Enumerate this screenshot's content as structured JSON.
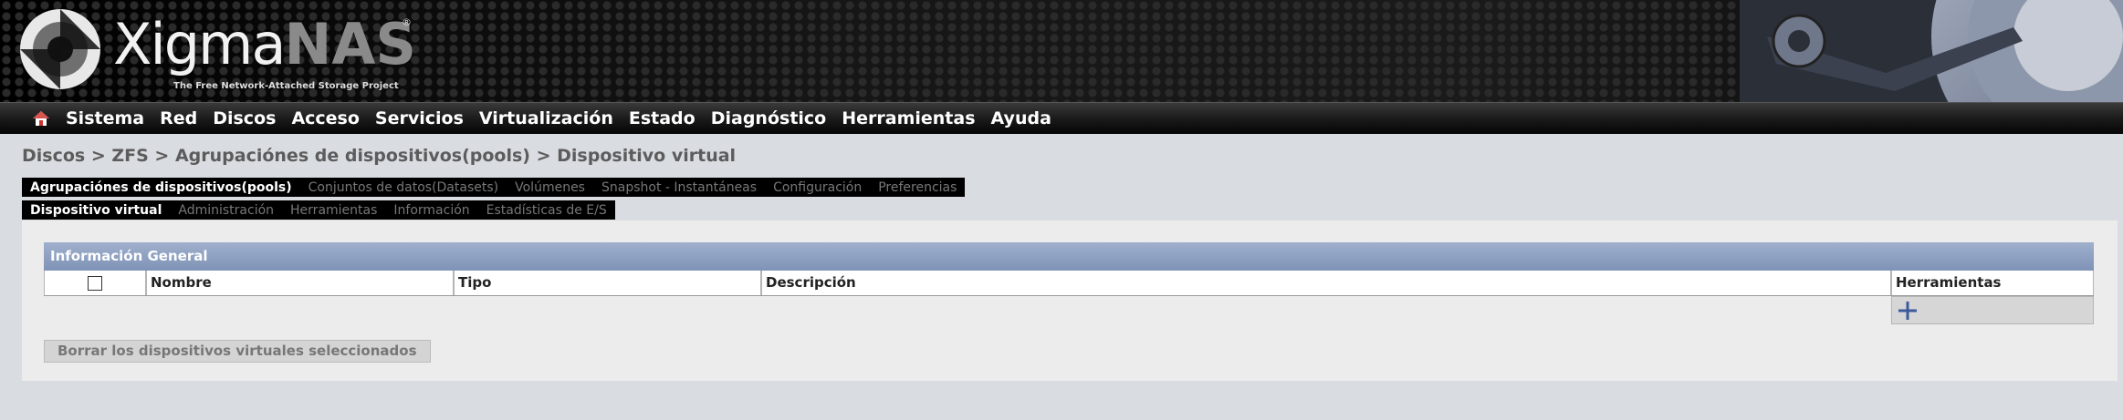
{
  "header": {
    "logo_main": "Xigma",
    "logo_accent": "NAS",
    "logo_reg": "®",
    "tagline": "The Free Network-Attached Storage Project"
  },
  "nav": {
    "items": [
      "Sistema",
      "Red",
      "Discos",
      "Acceso",
      "Servicios",
      "Virtualización",
      "Estado",
      "Diagnóstico",
      "Herramientas",
      "Ayuda"
    ]
  },
  "breadcrumb": "Discos > ZFS > Agrupaciónes de dispositivos(pools) > Dispositivo virtual",
  "tabs_level1": [
    {
      "label": "Agrupaciónes de dispositivos(pools)",
      "active": true
    },
    {
      "label": "Conjuntos de datos(Datasets)",
      "active": false
    },
    {
      "label": "Volúmenes",
      "active": false
    },
    {
      "label": "Snapshot - Instantáneas",
      "active": false
    },
    {
      "label": "Configuración",
      "active": false
    },
    {
      "label": "Preferencias",
      "active": false
    }
  ],
  "tabs_level2": [
    {
      "label": "Dispositivo virtual",
      "active": true
    },
    {
      "label": "Administración",
      "active": false
    },
    {
      "label": "Herramientas",
      "active": false
    },
    {
      "label": "Información",
      "active": false
    },
    {
      "label": "Estadísticas de E/S",
      "active": false
    }
  ],
  "table": {
    "title": "Información General",
    "columns": [
      "Nombre",
      "Tipo",
      "Descripción",
      "Herramientas"
    ]
  },
  "delete_button": "Borrar los dispositivos virtuales seleccionados",
  "colors": {
    "table_header": "#8a9cbd",
    "nav_bg": "#1b1b1b"
  },
  "icons": {
    "home": "home-icon",
    "add": "plus-icon"
  }
}
